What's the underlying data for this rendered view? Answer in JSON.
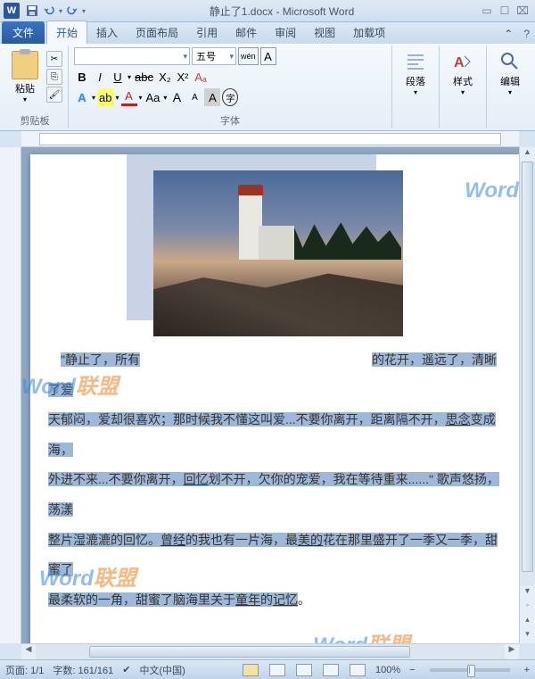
{
  "title": "静止了1.docx - Microsoft Word",
  "qat": {
    "save": "save-icon",
    "undo": "undo-icon",
    "redo": "redo-icon"
  },
  "tabs": {
    "file": "文件",
    "items": [
      "开始",
      "插入",
      "页面布局",
      "引用",
      "邮件",
      "审阅",
      "视图",
      "加载项"
    ],
    "active": 0
  },
  "ribbon": {
    "clipboard": {
      "label": "剪贴板",
      "paste": "粘贴"
    },
    "font": {
      "label": "字体",
      "name": "",
      "size": "五号",
      "bold": "B",
      "italic": "I",
      "underline": "U",
      "abc": "abc",
      "x2": "X₂",
      "x2sup": "X²",
      "ruby": "wén",
      "charborder": "A",
      "A_effect": "A",
      "highlight": "ab",
      "fontcolor": "A",
      "Aa": "Aa",
      "Aplus": "A",
      "Aminus": "A",
      "Afill": "A",
      "Acircle": "字"
    },
    "paragraph": {
      "label": "段落"
    },
    "styles": {
      "label": "样式"
    },
    "editing": {
      "label": "编辑"
    }
  },
  "document": {
    "text1a": "\"静止了，所有",
    "text1b": "的花开，遥远了，清晰了爱",
    "text2a": "天郁闷，爱却很喜欢；那时候我不懂这叫爱...不要你离开，距离隔不开，",
    "text2b": "思念",
    "text2c": "变成海，",
    "text3a": "外进不来...不要你离开，",
    "text3b": "回忆",
    "text3c": "划不开，欠你的宠爱，我在等待重来......\" 歌声悠扬，荡漾",
    "text4a": "整片湿漉漉的回忆。",
    "text4b": "曾经",
    "text4c": "的我也有一片海，最",
    "text4d": "美的",
    "text4e": "花在那里盛开了一季又一季，甜蜜了",
    "text5a": "最柔软的一角，甜蜜了脑海里关于",
    "text5b": "童年",
    "text5c": "的",
    "text5d": "记忆",
    "text5e": "。"
  },
  "watermark": {
    "word": "Word",
    "alliance": "联盟"
  },
  "status": {
    "page": "页面: 1/1",
    "words": "字数: 161/161",
    "lang": "中文(中国)",
    "zoom": "100%",
    "minus": "−",
    "plus": "+"
  }
}
